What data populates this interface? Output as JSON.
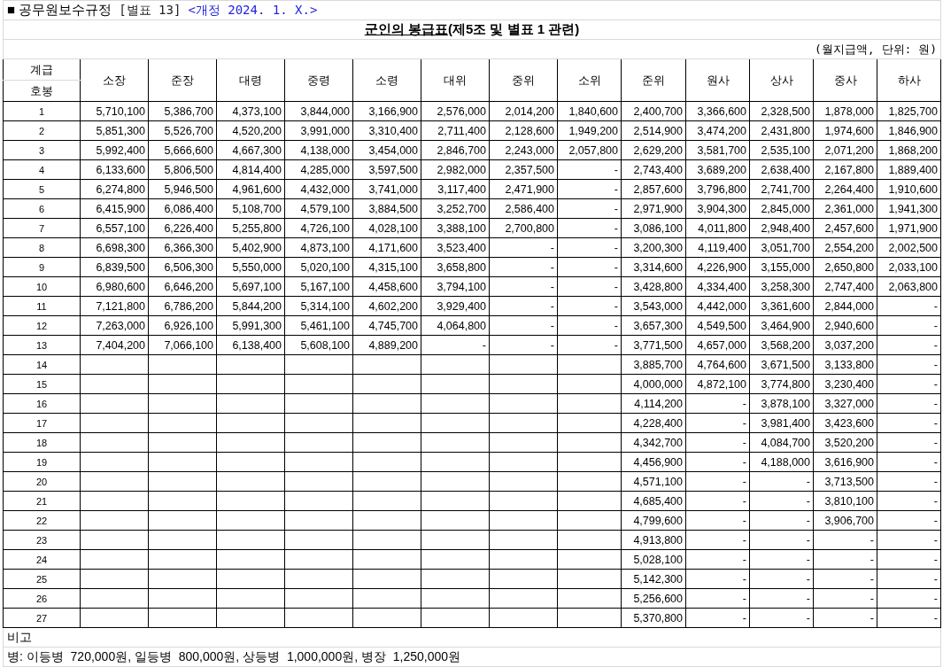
{
  "header": {
    "document": "■ 공무원보수규정",
    "table_number": "[별표 13]",
    "revision": "<개정 2024. 1. X.>"
  },
  "title": {
    "main": "군인의 봉급표",
    "suffix": "(제5조 및 별표 1 관련)"
  },
  "unit_note": "(월지급액, 단위: 원)",
  "table": {
    "corner_top": "계급",
    "corner_bottom": "호봉",
    "columns": [
      "소장",
      "준장",
      "대령",
      "중령",
      "소령",
      "대위",
      "중위",
      "소위",
      "준위",
      "원사",
      "상사",
      "중사",
      "하사"
    ],
    "rows": [
      {
        "step": "1",
        "values": [
          "5,710,100",
          "5,386,700",
          "4,373,100",
          "3,844,000",
          "3,166,900",
          "2,576,000",
          "2,014,200",
          "1,840,600",
          "2,400,700",
          "3,366,600",
          "2,328,500",
          "1,878,000",
          "1,825,700"
        ]
      },
      {
        "step": "2",
        "values": [
          "5,851,300",
          "5,526,700",
          "4,520,200",
          "3,991,000",
          "3,310,400",
          "2,711,400",
          "2,128,600",
          "1,949,200",
          "2,514,900",
          "3,474,200",
          "2,431,800",
          "1,974,600",
          "1,846,900"
        ]
      },
      {
        "step": "3",
        "values": [
          "5,992,400",
          "5,666,600",
          "4,667,300",
          "4,138,000",
          "3,454,000",
          "2,846,700",
          "2,243,000",
          "2,057,800",
          "2,629,200",
          "3,581,700",
          "2,535,100",
          "2,071,200",
          "1,868,200"
        ]
      },
      {
        "step": "4",
        "values": [
          "6,133,600",
          "5,806,500",
          "4,814,400",
          "4,285,000",
          "3,597,500",
          "2,982,000",
          "2,357,500",
          "-",
          "2,743,400",
          "3,689,200",
          "2,638,400",
          "2,167,800",
          "1,889,400"
        ]
      },
      {
        "step": "5",
        "values": [
          "6,274,800",
          "5,946,500",
          "4,961,600",
          "4,432,000",
          "3,741,000",
          "3,117,400",
          "2,471,900",
          "-",
          "2,857,600",
          "3,796,800",
          "2,741,700",
          "2,264,400",
          "1,910,600"
        ]
      },
      {
        "step": "6",
        "values": [
          "6,415,900",
          "6,086,400",
          "5,108,700",
          "4,579,100",
          "3,884,500",
          "3,252,700",
          "2,586,400",
          "-",
          "2,971,900",
          "3,904,300",
          "2,845,000",
          "2,361,000",
          "1,941,300"
        ]
      },
      {
        "step": "7",
        "values": [
          "6,557,100",
          "6,226,400",
          "5,255,800",
          "4,726,100",
          "4,028,100",
          "3,388,100",
          "2,700,800",
          "-",
          "3,086,100",
          "4,011,800",
          "2,948,400",
          "2,457,600",
          "1,971,900"
        ]
      },
      {
        "step": "8",
        "values": [
          "6,698,300",
          "6,366,300",
          "5,402,900",
          "4,873,100",
          "4,171,600",
          "3,523,400",
          "-",
          "-",
          "3,200,300",
          "4,119,400",
          "3,051,700",
          "2,554,200",
          "2,002,500"
        ]
      },
      {
        "step": "9",
        "values": [
          "6,839,500",
          "6,506,300",
          "5,550,000",
          "5,020,100",
          "4,315,100",
          "3,658,800",
          "-",
          "-",
          "3,314,600",
          "4,226,900",
          "3,155,000",
          "2,650,800",
          "2,033,100"
        ]
      },
      {
        "step": "10",
        "values": [
          "6,980,600",
          "6,646,200",
          "5,697,100",
          "5,167,100",
          "4,458,600",
          "3,794,100",
          "-",
          "-",
          "3,428,800",
          "4,334,400",
          "3,258,300",
          "2,747,400",
          "2,063,800"
        ]
      },
      {
        "step": "11",
        "values": [
          "7,121,800",
          "6,786,200",
          "5,844,200",
          "5,314,100",
          "4,602,200",
          "3,929,400",
          "-",
          "-",
          "3,543,000",
          "4,442,000",
          "3,361,600",
          "2,844,000",
          "-"
        ]
      },
      {
        "step": "12",
        "values": [
          "7,263,000",
          "6,926,100",
          "5,991,300",
          "5,461,100",
          "4,745,700",
          "4,064,800",
          "-",
          "-",
          "3,657,300",
          "4,549,500",
          "3,464,900",
          "2,940,600",
          "-"
        ]
      },
      {
        "step": "13",
        "values": [
          "7,404,200",
          "7,066,100",
          "6,138,400",
          "5,608,100",
          "4,889,200",
          "-",
          "-",
          "-",
          "3,771,500",
          "4,657,000",
          "3,568,200",
          "3,037,200",
          "-"
        ]
      },
      {
        "step": "14",
        "values": [
          "3,885,700",
          "4,764,600",
          "3,671,500",
          "3,133,800",
          "-"
        ]
      },
      {
        "step": "15",
        "values": [
          "4,000,000",
          "4,872,100",
          "3,774,800",
          "3,230,400",
          "-"
        ]
      },
      {
        "step": "16",
        "values": [
          "4,114,200",
          "-",
          "3,878,100",
          "3,327,000",
          "-"
        ]
      },
      {
        "step": "17",
        "values": [
          "4,228,400",
          "-",
          "3,981,400",
          "3,423,600",
          "-"
        ]
      },
      {
        "step": "18",
        "values": [
          "4,342,700",
          "-",
          "4,084,700",
          "3,520,200",
          "-"
        ]
      },
      {
        "step": "19",
        "values": [
          "4,456,900",
          "-",
          "4,188,000",
          "3,616,900",
          "-"
        ]
      },
      {
        "step": "20",
        "values": [
          "4,571,100",
          "-",
          "-",
          "3,713,500",
          "-"
        ]
      },
      {
        "step": "21",
        "values": [
          "4,685,400",
          "-",
          "-",
          "3,810,100",
          "-"
        ]
      },
      {
        "step": "22",
        "values": [
          "4,799,600",
          "-",
          "-",
          "3,906,700",
          "-"
        ]
      },
      {
        "step": "23",
        "values": [
          "4,913,800",
          "-",
          "-",
          "-",
          "-"
        ]
      },
      {
        "step": "24",
        "values": [
          "5,028,100",
          "-",
          "-",
          "-",
          "-"
        ]
      },
      {
        "step": "25",
        "values": [
          "5,142,300",
          "-",
          "-",
          "-",
          "-"
        ]
      },
      {
        "step": "26",
        "values": [
          "5,256,600",
          "-",
          "-",
          "-",
          "-"
        ]
      },
      {
        "step": "27",
        "values": [
          "5,370,800",
          "-",
          "-",
          "-",
          "-"
        ]
      }
    ]
  },
  "remarks": {
    "label": "비고",
    "text": "병: 이등병  720,000원, 일등병  800,000원, 상등병  1,000,000원, 병장  1,250,000원"
  }
}
